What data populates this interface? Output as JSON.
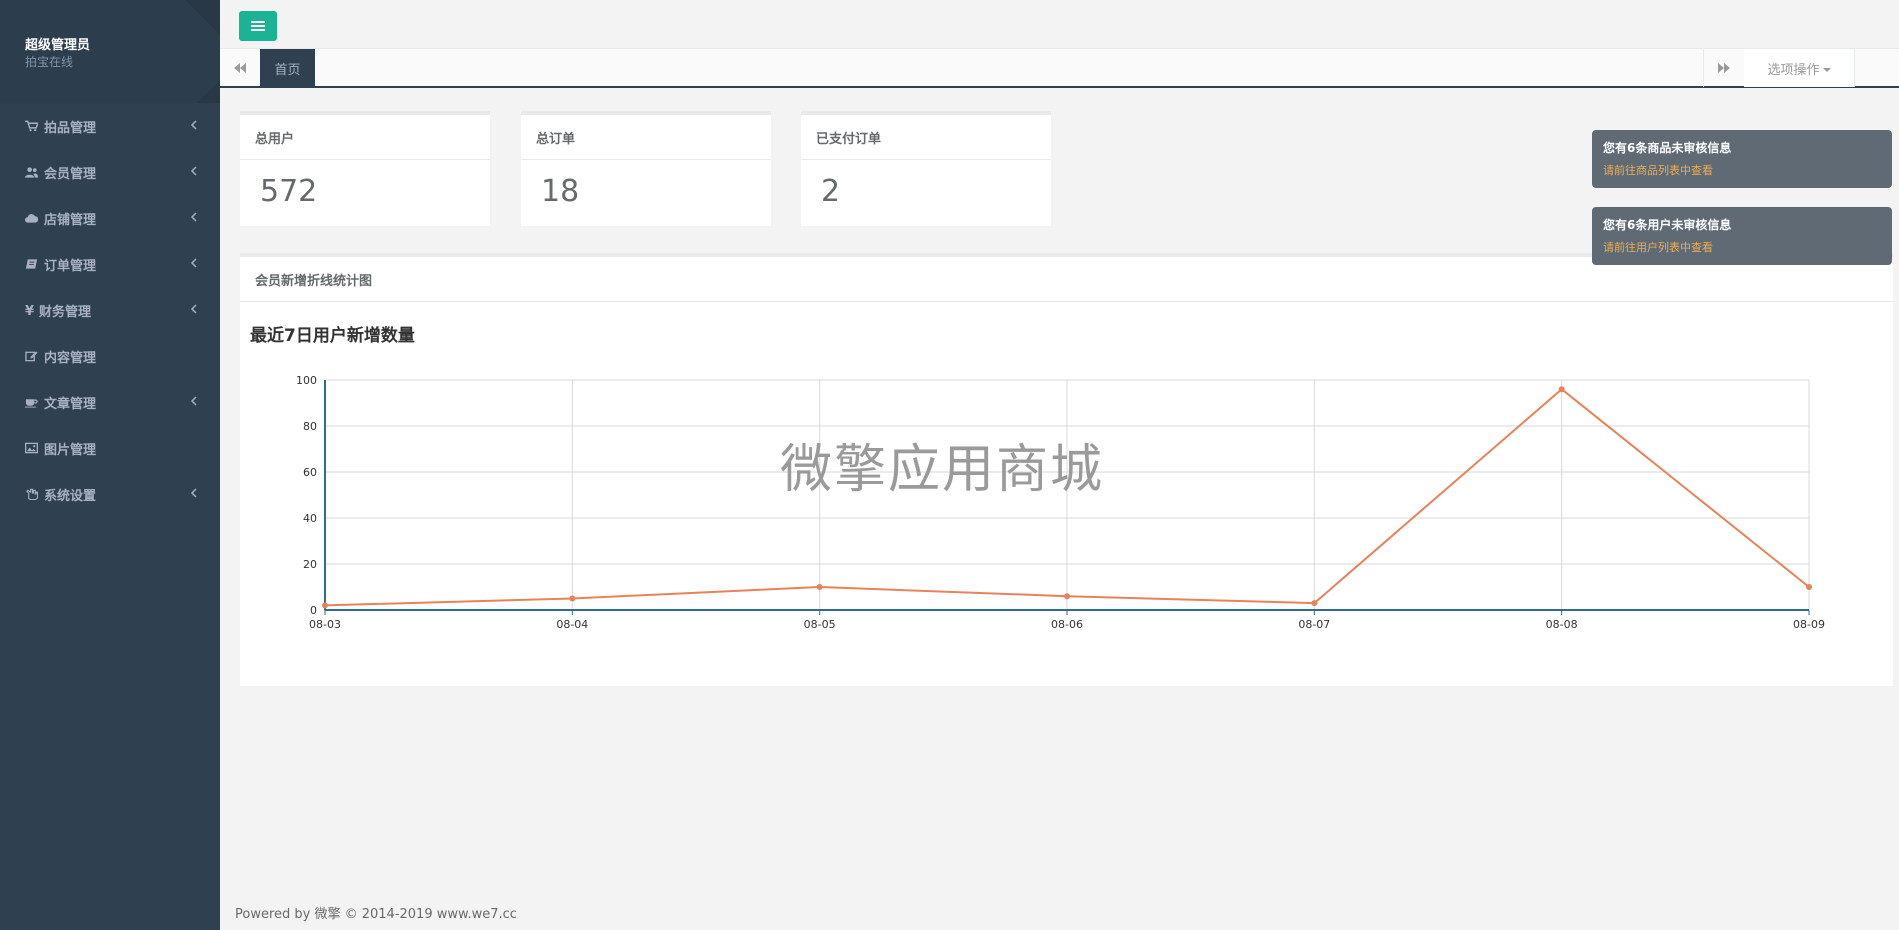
{
  "sidebar": {
    "profile_name": "超级管理员",
    "profile_sub": "拍宝在线",
    "items": [
      {
        "label": "拍品管理",
        "icon": "cart-icon",
        "has_sub": true
      },
      {
        "label": "会员管理",
        "icon": "users-icon",
        "has_sub": true
      },
      {
        "label": "店铺管理",
        "icon": "cloud-icon",
        "has_sub": true
      },
      {
        "label": "订单管理",
        "icon": "book-icon",
        "has_sub": true
      },
      {
        "label": "财务管理",
        "icon": "yen-icon",
        "has_sub": true
      },
      {
        "label": "内容管理",
        "icon": "edit-icon",
        "has_sub": false
      },
      {
        "label": "文章管理",
        "icon": "coffee-icon",
        "has_sub": true
      },
      {
        "label": "图片管理",
        "icon": "image-icon",
        "has_sub": false
      },
      {
        "label": "系统设置",
        "icon": "hand-icon",
        "has_sub": true
      }
    ]
  },
  "tabs": {
    "home_label": "首页",
    "options_label": "选项操作"
  },
  "stats": [
    {
      "title": "总用户",
      "value": "572"
    },
    {
      "title": "总订单",
      "value": "18"
    },
    {
      "title": "已支付订单",
      "value": "2"
    }
  ],
  "panel": {
    "title": "会员新增折线统计图",
    "watermark": "微擎应用商城"
  },
  "chart_data": {
    "type": "line",
    "title": "最近7日用户新增数量",
    "xlabel": "",
    "ylabel": "",
    "categories": [
      "08-03",
      "08-04",
      "08-05",
      "08-06",
      "08-07",
      "08-08",
      "08-09"
    ],
    "series": [
      {
        "values": [
          2,
          5,
          10,
          6,
          3,
          96,
          10
        ],
        "color": "#e9825a"
      }
    ],
    "ylim": [
      0,
      100
    ],
    "yticks": [
      0,
      20,
      40,
      60,
      80,
      100
    ],
    "grid": true,
    "axis_color": "#2f6b8a"
  },
  "notifications": [
    {
      "title": "您有6条商品未审核信息",
      "link": "请前往商品列表中查看"
    },
    {
      "title": "您有6条用户未审核信息",
      "link": "请前往用户列表中查看"
    }
  ],
  "footer": {
    "text": "Powered by 微擎 © 2014-2019 www.we7.cc"
  },
  "colors": {
    "accent": "#1ab394",
    "sidebar_bg": "#2f4050",
    "line": "#e9825a",
    "notice_link": "#f0ad4e"
  }
}
